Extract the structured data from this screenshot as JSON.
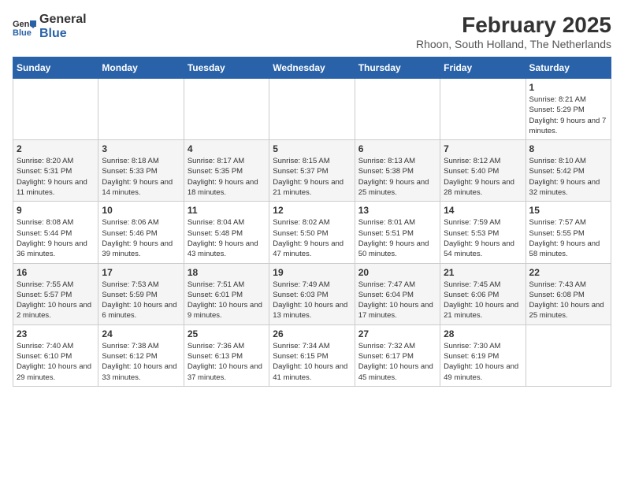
{
  "header": {
    "logo": {
      "general": "General",
      "blue": "Blue"
    },
    "title": "February 2025",
    "subtitle": "Rhoon, South Holland, The Netherlands"
  },
  "weekdays": [
    "Sunday",
    "Monday",
    "Tuesday",
    "Wednesday",
    "Thursday",
    "Friday",
    "Saturday"
  ],
  "weeks": [
    {
      "days": [
        {
          "num": "",
          "info": ""
        },
        {
          "num": "",
          "info": ""
        },
        {
          "num": "",
          "info": ""
        },
        {
          "num": "",
          "info": ""
        },
        {
          "num": "",
          "info": ""
        },
        {
          "num": "",
          "info": ""
        },
        {
          "num": "1",
          "info": "Sunrise: 8:21 AM\nSunset: 5:29 PM\nDaylight: 9 hours and 7 minutes."
        }
      ]
    },
    {
      "days": [
        {
          "num": "2",
          "info": "Sunrise: 8:20 AM\nSunset: 5:31 PM\nDaylight: 9 hours and 11 minutes."
        },
        {
          "num": "3",
          "info": "Sunrise: 8:18 AM\nSunset: 5:33 PM\nDaylight: 9 hours and 14 minutes."
        },
        {
          "num": "4",
          "info": "Sunrise: 8:17 AM\nSunset: 5:35 PM\nDaylight: 9 hours and 18 minutes."
        },
        {
          "num": "5",
          "info": "Sunrise: 8:15 AM\nSunset: 5:37 PM\nDaylight: 9 hours and 21 minutes."
        },
        {
          "num": "6",
          "info": "Sunrise: 8:13 AM\nSunset: 5:38 PM\nDaylight: 9 hours and 25 minutes."
        },
        {
          "num": "7",
          "info": "Sunrise: 8:12 AM\nSunset: 5:40 PM\nDaylight: 9 hours and 28 minutes."
        },
        {
          "num": "8",
          "info": "Sunrise: 8:10 AM\nSunset: 5:42 PM\nDaylight: 9 hours and 32 minutes."
        }
      ]
    },
    {
      "days": [
        {
          "num": "9",
          "info": "Sunrise: 8:08 AM\nSunset: 5:44 PM\nDaylight: 9 hours and 36 minutes."
        },
        {
          "num": "10",
          "info": "Sunrise: 8:06 AM\nSunset: 5:46 PM\nDaylight: 9 hours and 39 minutes."
        },
        {
          "num": "11",
          "info": "Sunrise: 8:04 AM\nSunset: 5:48 PM\nDaylight: 9 hours and 43 minutes."
        },
        {
          "num": "12",
          "info": "Sunrise: 8:02 AM\nSunset: 5:50 PM\nDaylight: 9 hours and 47 minutes."
        },
        {
          "num": "13",
          "info": "Sunrise: 8:01 AM\nSunset: 5:51 PM\nDaylight: 9 hours and 50 minutes."
        },
        {
          "num": "14",
          "info": "Sunrise: 7:59 AM\nSunset: 5:53 PM\nDaylight: 9 hours and 54 minutes."
        },
        {
          "num": "15",
          "info": "Sunrise: 7:57 AM\nSunset: 5:55 PM\nDaylight: 9 hours and 58 minutes."
        }
      ]
    },
    {
      "days": [
        {
          "num": "16",
          "info": "Sunrise: 7:55 AM\nSunset: 5:57 PM\nDaylight: 10 hours and 2 minutes."
        },
        {
          "num": "17",
          "info": "Sunrise: 7:53 AM\nSunset: 5:59 PM\nDaylight: 10 hours and 6 minutes."
        },
        {
          "num": "18",
          "info": "Sunrise: 7:51 AM\nSunset: 6:01 PM\nDaylight: 10 hours and 9 minutes."
        },
        {
          "num": "19",
          "info": "Sunrise: 7:49 AM\nSunset: 6:03 PM\nDaylight: 10 hours and 13 minutes."
        },
        {
          "num": "20",
          "info": "Sunrise: 7:47 AM\nSunset: 6:04 PM\nDaylight: 10 hours and 17 minutes."
        },
        {
          "num": "21",
          "info": "Sunrise: 7:45 AM\nSunset: 6:06 PM\nDaylight: 10 hours and 21 minutes."
        },
        {
          "num": "22",
          "info": "Sunrise: 7:43 AM\nSunset: 6:08 PM\nDaylight: 10 hours and 25 minutes."
        }
      ]
    },
    {
      "days": [
        {
          "num": "23",
          "info": "Sunrise: 7:40 AM\nSunset: 6:10 PM\nDaylight: 10 hours and 29 minutes."
        },
        {
          "num": "24",
          "info": "Sunrise: 7:38 AM\nSunset: 6:12 PM\nDaylight: 10 hours and 33 minutes."
        },
        {
          "num": "25",
          "info": "Sunrise: 7:36 AM\nSunset: 6:13 PM\nDaylight: 10 hours and 37 minutes."
        },
        {
          "num": "26",
          "info": "Sunrise: 7:34 AM\nSunset: 6:15 PM\nDaylight: 10 hours and 41 minutes."
        },
        {
          "num": "27",
          "info": "Sunrise: 7:32 AM\nSunset: 6:17 PM\nDaylight: 10 hours and 45 minutes."
        },
        {
          "num": "28",
          "info": "Sunrise: 7:30 AM\nSunset: 6:19 PM\nDaylight: 10 hours and 49 minutes."
        },
        {
          "num": "",
          "info": ""
        }
      ]
    }
  ]
}
